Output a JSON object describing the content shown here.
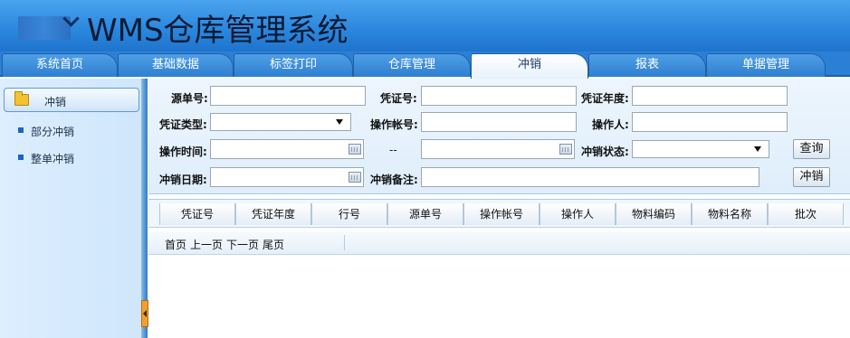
{
  "header": {
    "title": "WMS仓库管理系统"
  },
  "tabs": [
    {
      "label": "系统首页",
      "active": false
    },
    {
      "label": "基础数据",
      "active": false
    },
    {
      "label": "标签打印",
      "active": false
    },
    {
      "label": "仓库管理",
      "active": false
    },
    {
      "label": "冲销",
      "active": true
    },
    {
      "label": "报表",
      "active": false
    },
    {
      "label": "单据管理",
      "active": false
    }
  ],
  "sidebar": {
    "header_label": "冲销",
    "items": [
      {
        "label": "部分冲销"
      },
      {
        "label": "整单冲销"
      }
    ]
  },
  "form": {
    "labels": {
      "source_no": "源单号:",
      "voucher_no": "凭证号:",
      "voucher_year": "凭证年度:",
      "voucher_type": "凭证类型:",
      "operator_account": "操作帐号:",
      "operator": "操作人:",
      "operate_time": "操作时间:",
      "range_sep": "--",
      "reversal_status": "冲销状态:",
      "reversal_date": "冲销日期:",
      "reversal_remark": "冲销备注:"
    },
    "values": {
      "source_no": "",
      "voucher_no": "",
      "voucher_year": "",
      "voucher_type": "",
      "operator_account": "",
      "operator": "",
      "operate_time_from": "",
      "operate_time_to": "",
      "reversal_status": "",
      "reversal_date": "",
      "reversal_remark": ""
    },
    "buttons": {
      "query": "查询",
      "reverse": "冲销"
    }
  },
  "table": {
    "columns": [
      "凭证号",
      "凭证年度",
      "行号",
      "源单号",
      "操作帐号",
      "操作人",
      "物料编码",
      "物料名称",
      "批次"
    ]
  },
  "pager": {
    "first": "首页",
    "prev": "上一页",
    "next": "下一页",
    "last": "尾页"
  },
  "colors": {
    "header_blue": "#2a86dd",
    "sidebar_bg": "#dceeff",
    "accent": "#1a64c6"
  },
  "icons": [
    "folder-icon",
    "calendar-icon",
    "dropdown-arrow-icon",
    "collapse-arrow-icon"
  ]
}
